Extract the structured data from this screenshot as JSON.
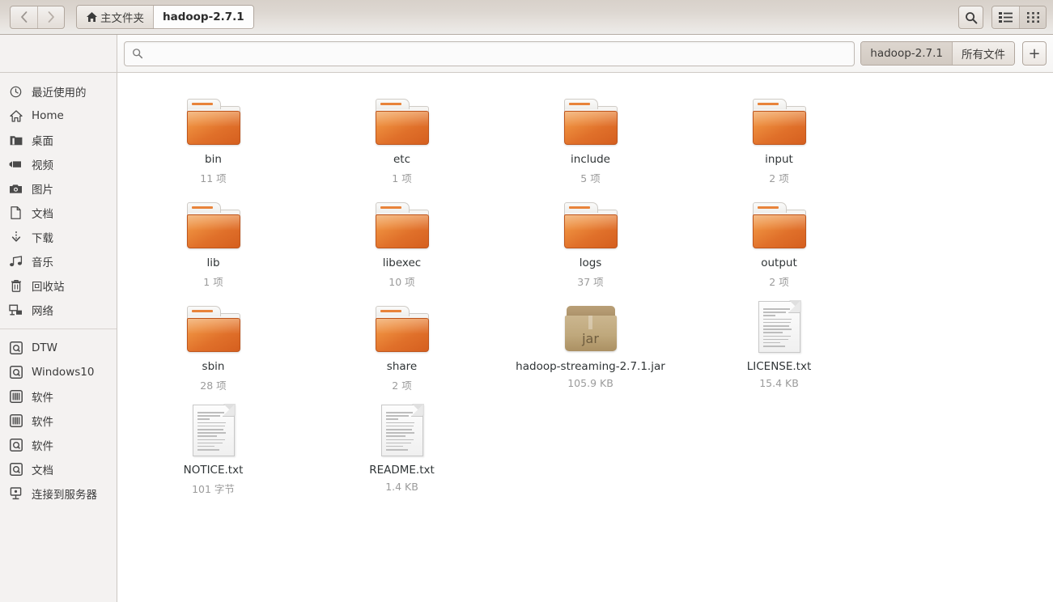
{
  "window": {
    "title": "hadoop-2.7.1"
  },
  "header": {
    "back_label": "‹",
    "forward_label": "›",
    "breadcrumbs": [
      {
        "label": "主文件夹",
        "icon": "home-icon",
        "active": false
      },
      {
        "label": "hadoop-2.7.1",
        "icon": "",
        "active": true
      }
    ],
    "search_button": "search-icon",
    "view_list": "list-view-icon",
    "view_grid": "grid-view-icon"
  },
  "search": {
    "value": "",
    "placeholder": "",
    "icon": "search-icon"
  },
  "tabs": {
    "items": [
      {
        "label": "hadoop-2.7.1",
        "active": true
      },
      {
        "label": "所有文件",
        "active": false
      }
    ],
    "new_tab_label": "+"
  },
  "sidebar": {
    "group1": [
      {
        "label": "最近使用的",
        "icon": "clock-icon"
      },
      {
        "label": "Home",
        "icon": "home-icon"
      },
      {
        "label": "桌面",
        "icon": "folder-icon"
      },
      {
        "label": "视频",
        "icon": "video-icon"
      },
      {
        "label": "图片",
        "icon": "camera-icon"
      },
      {
        "label": "文档",
        "icon": "document-icon"
      },
      {
        "label": "下载",
        "icon": "download-icon"
      },
      {
        "label": "音乐",
        "icon": "music-icon"
      },
      {
        "label": "回收站",
        "icon": "trash-icon"
      },
      {
        "label": "网络",
        "icon": "network-icon"
      }
    ],
    "group2": [
      {
        "label": "DTW",
        "icon": "drive-icon"
      },
      {
        "label": "Windows10",
        "icon": "drive-icon"
      },
      {
        "label": "软件",
        "icon": "disc-icon"
      },
      {
        "label": "软件",
        "icon": "disc-icon"
      },
      {
        "label": "软件",
        "icon": "drive-icon"
      },
      {
        "label": "文档",
        "icon": "drive-icon"
      },
      {
        "label": "连接到服务器",
        "icon": "server-icon"
      }
    ]
  },
  "files": [
    {
      "name": "bin",
      "meta": "11 项",
      "type": "folder"
    },
    {
      "name": "etc",
      "meta": "1 项",
      "type": "folder"
    },
    {
      "name": "include",
      "meta": "5 项",
      "type": "folder"
    },
    {
      "name": "input",
      "meta": "2 项",
      "type": "folder"
    },
    {
      "name": "lib",
      "meta": "1 项",
      "type": "folder"
    },
    {
      "name": "libexec",
      "meta": "10 项",
      "type": "folder"
    },
    {
      "name": "logs",
      "meta": "37 项",
      "type": "folder"
    },
    {
      "name": "output",
      "meta": "2 项",
      "type": "folder"
    },
    {
      "name": "sbin",
      "meta": "28 项",
      "type": "folder"
    },
    {
      "name": "share",
      "meta": "2 项",
      "type": "folder"
    },
    {
      "name": "hadoop-streaming-2.7.1.jar",
      "meta": "105.9 KB",
      "type": "archive",
      "badge": "jar"
    },
    {
      "name": "LICENSE.txt",
      "meta": "15.4 KB",
      "type": "document"
    },
    {
      "name": "NOTICE.txt",
      "meta": "101 字节",
      "type": "document"
    },
    {
      "name": "README.txt",
      "meta": "1.4 KB",
      "type": "document"
    }
  ],
  "colors": {
    "folder_orange": "#e0702a",
    "folder_stripe": "#e8833a",
    "archive_tan": "#bfa87c",
    "header_bg": "#ddd7d1",
    "sidebar_bg": "#f4f2f1",
    "name_text": "#2f3436",
    "meta_text": "#9b9b9b"
  }
}
